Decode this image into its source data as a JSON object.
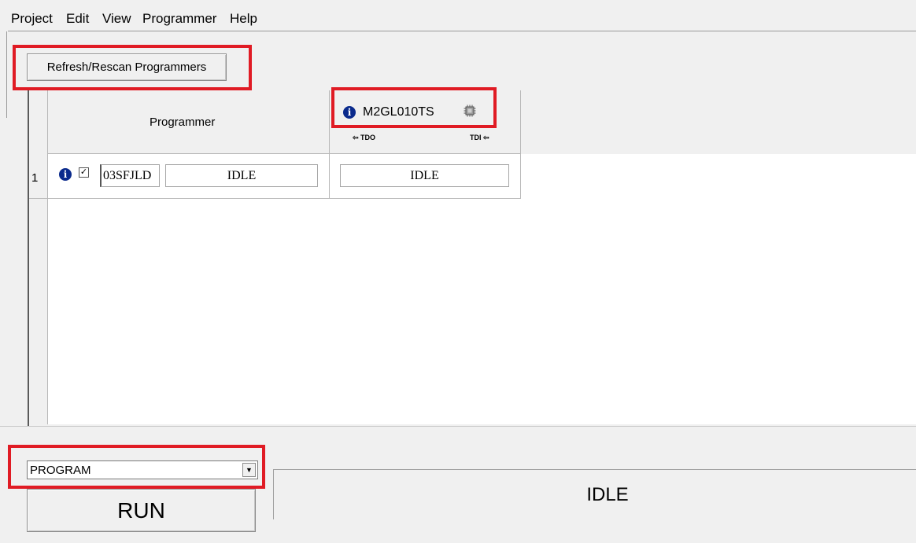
{
  "menu": {
    "items": [
      "Project",
      "Edit",
      "View",
      "Programmer",
      "Help"
    ]
  },
  "toolbar": {
    "refresh_label": "Refresh/Rescan Programmers"
  },
  "grid": {
    "programmer_header": "Programmer",
    "device": {
      "name": "M2GL010TS",
      "tdo_label": "⇦ TDO",
      "tdi_label": "TDI ⇦",
      "icons": [
        "info-icon",
        "chip-icon"
      ]
    },
    "rows": [
      {
        "number": "1",
        "checked": true,
        "programmer_id": "03SFJLD",
        "programmer_status": "IDLE",
        "device_status": "IDLE"
      }
    ]
  },
  "action": {
    "selected": "PROGRAM",
    "run_label": "RUN"
  },
  "status": {
    "text": "IDLE"
  },
  "colors": {
    "highlight": "#e01b24",
    "info_icon": "#0a2a8c",
    "window_bg": "#f0f0f0"
  }
}
